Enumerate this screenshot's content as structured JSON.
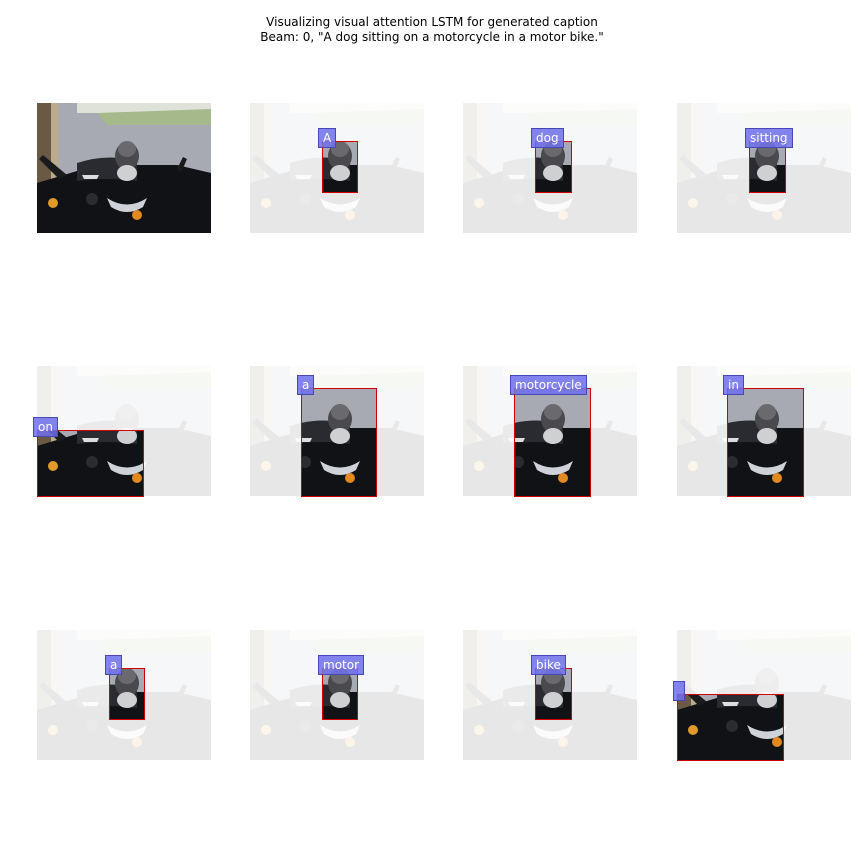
{
  "title": {
    "line1": "Visualizing visual attention LSTM for generated caption",
    "line2": "Beam: 0, \"A dog sitting on a motorcycle in a motor bike.\""
  },
  "original_image": "dog on motorcycle photo",
  "words": [
    {
      "label": "A"
    },
    {
      "label": "dog"
    },
    {
      "label": "sitting"
    },
    {
      "label": "on"
    },
    {
      "label": "a"
    },
    {
      "label": "motorcycle"
    },
    {
      "label": "in"
    },
    {
      "label": "a"
    },
    {
      "label": "motor"
    },
    {
      "label": "bike"
    },
    {
      "label": ""
    }
  ],
  "colors": {
    "attention_box": "#d40000",
    "word_label": "#6e6eeb"
  }
}
